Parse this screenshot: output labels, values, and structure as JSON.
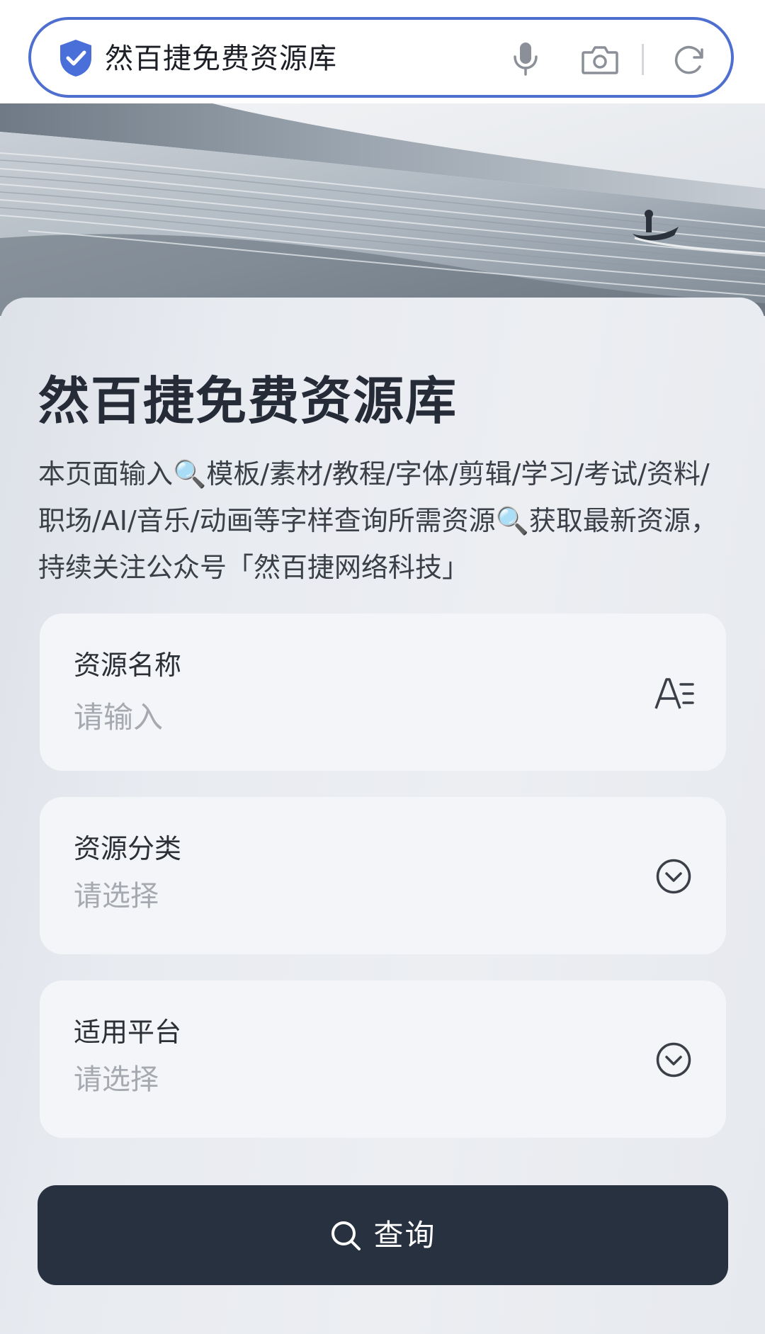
{
  "search_bar": {
    "query": "然百捷免费资源库"
  },
  "header": {
    "title": "然百捷免费资源库",
    "description": "本页面输入🔍模板/素材/教程/字体/剪辑/学习/考试/资料/职场/AI/音乐/动画等字样查询所需资源🔍获取最新资源，持续关注公众号「然百捷网络科技」"
  },
  "form": {
    "name_field": {
      "label": "资源名称",
      "placeholder": "请输入"
    },
    "category_field": {
      "label": "资源分类",
      "value": "请选择"
    },
    "platform_field": {
      "label": "适用平台",
      "value": "请选择"
    },
    "submit_label": "查询"
  },
  "icons": {
    "search_bar": [
      "shield-check-icon",
      "microphone-icon",
      "camera-icon",
      "refresh-icon"
    ],
    "name_field": "font-size-icon",
    "select_fields": "chevron-down-circle-icon",
    "submit": "search-icon"
  },
  "colors": {
    "search_border": "#4f6fd0",
    "shield": "#4a6fd9",
    "button_bg": "#28313f",
    "title": "#262c37",
    "placeholder": "#a6a9b0"
  }
}
